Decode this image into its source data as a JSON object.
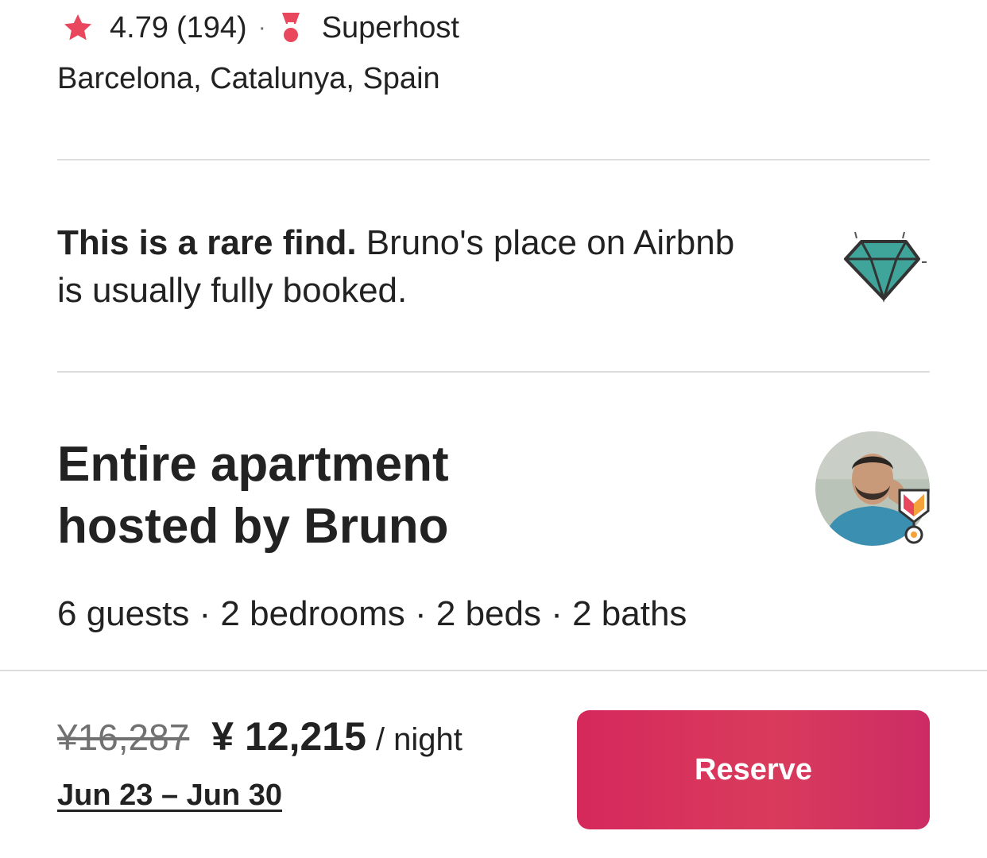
{
  "rating": {
    "score": "4.79",
    "count": "(194)",
    "separator": "·",
    "superhost_label": "Superhost",
    "star_icon": "star-icon",
    "medal_icon": "superhost-medal-icon"
  },
  "location": "Barcelona, Catalunya, Spain",
  "rare_find": {
    "bold": "This is a rare find.",
    "text": " Bruno's place on Airbnb is usually fully booked.",
    "icon": "diamond-icon"
  },
  "listing": {
    "title_line1": "Entire apartment",
    "title_line2": "hosted by Bruno",
    "details": "6 guests · 2 bedrooms · 2 beds · 2 baths",
    "host_avatar": "host-avatar",
    "host_badge": "superhost-badge-icon"
  },
  "booking": {
    "original_price": "¥16,287",
    "price": "¥ 12,215",
    "per_night": "/ night",
    "dates": "Jun 23 – Jun 30",
    "reserve_label": "Reserve"
  },
  "colors": {
    "brand": "#E31C5F",
    "star": "#E8475E",
    "text": "#222222",
    "muted": "#717171",
    "divider": "#DDDDDD",
    "diamond": "#3FA59A"
  }
}
